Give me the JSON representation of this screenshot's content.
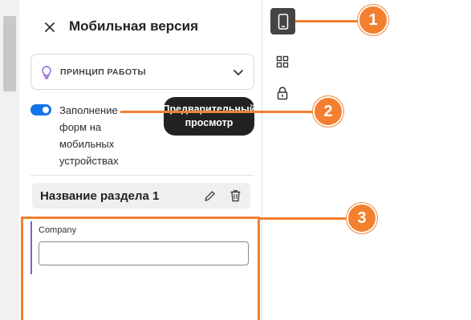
{
  "panel": {
    "title": "Мобильная версия",
    "how_it_works": "ПРИНЦИП РАБОТЫ",
    "toggle": {
      "label": "Заполнение форм на мобильных устройствах",
      "state": "on"
    },
    "preview_button": "Предварительный просмотр",
    "section": {
      "title": "Название раздела 1"
    },
    "field": {
      "label": "Company",
      "value": ""
    }
  },
  "callouts": [
    "1",
    "2",
    "3"
  ],
  "icons": {
    "close": "close-icon",
    "bulb": "lightbulb-icon",
    "chevron": "chevron-down-icon",
    "edit": "pencil-icon",
    "delete": "trash-icon",
    "mobile": "mobile-phone-icon",
    "grid": "grid-icon",
    "lock": "lock-icon"
  },
  "colors": {
    "accent": "#1473e6",
    "callout": "#f2802f",
    "field_marker": "#7b5dd6",
    "tool_active": "#444444",
    "preview_bg": "#222222"
  }
}
